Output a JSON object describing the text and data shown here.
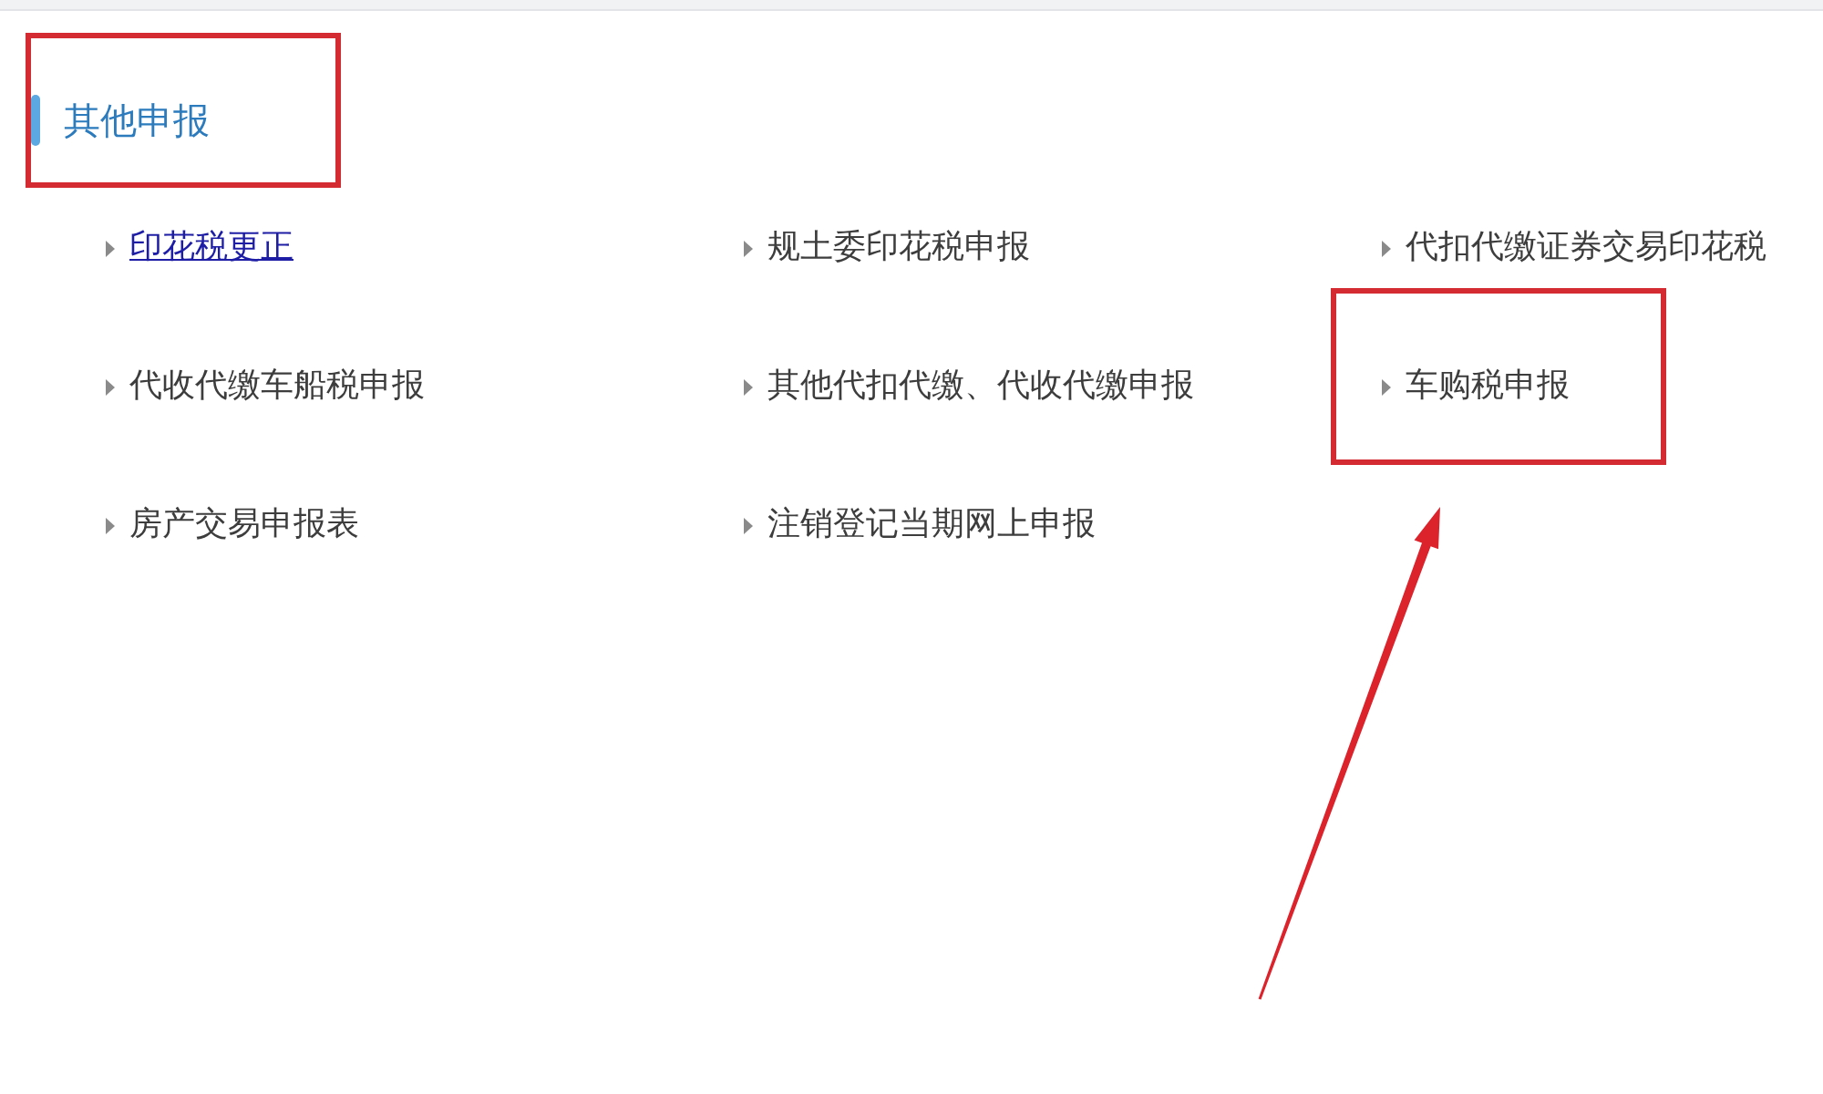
{
  "section": {
    "title": "其他申报",
    "highlighted": true
  },
  "items": [
    {
      "label": "印花税更正",
      "hovered": true,
      "highlighted": false,
      "arrow": false
    },
    {
      "label": "规土委印花税申报",
      "hovered": false,
      "highlighted": false,
      "arrow": false
    },
    {
      "label": "代扣代缴证券交易印花税",
      "hovered": false,
      "highlighted": false,
      "arrow": false
    },
    {
      "label": "代收代缴车船税申报",
      "hovered": false,
      "highlighted": false,
      "arrow": false
    },
    {
      "label": "其他代扣代缴、代收代缴申报",
      "hovered": false,
      "highlighted": false,
      "arrow": false
    },
    {
      "label": "车购税申报",
      "hovered": false,
      "highlighted": true,
      "arrow": true
    },
    {
      "label": "房产交易申报表",
      "hovered": false,
      "highlighted": false,
      "arrow": false
    },
    {
      "label": "注销登记当期网上申报",
      "hovered": false,
      "highlighted": false,
      "arrow": false
    }
  ]
}
